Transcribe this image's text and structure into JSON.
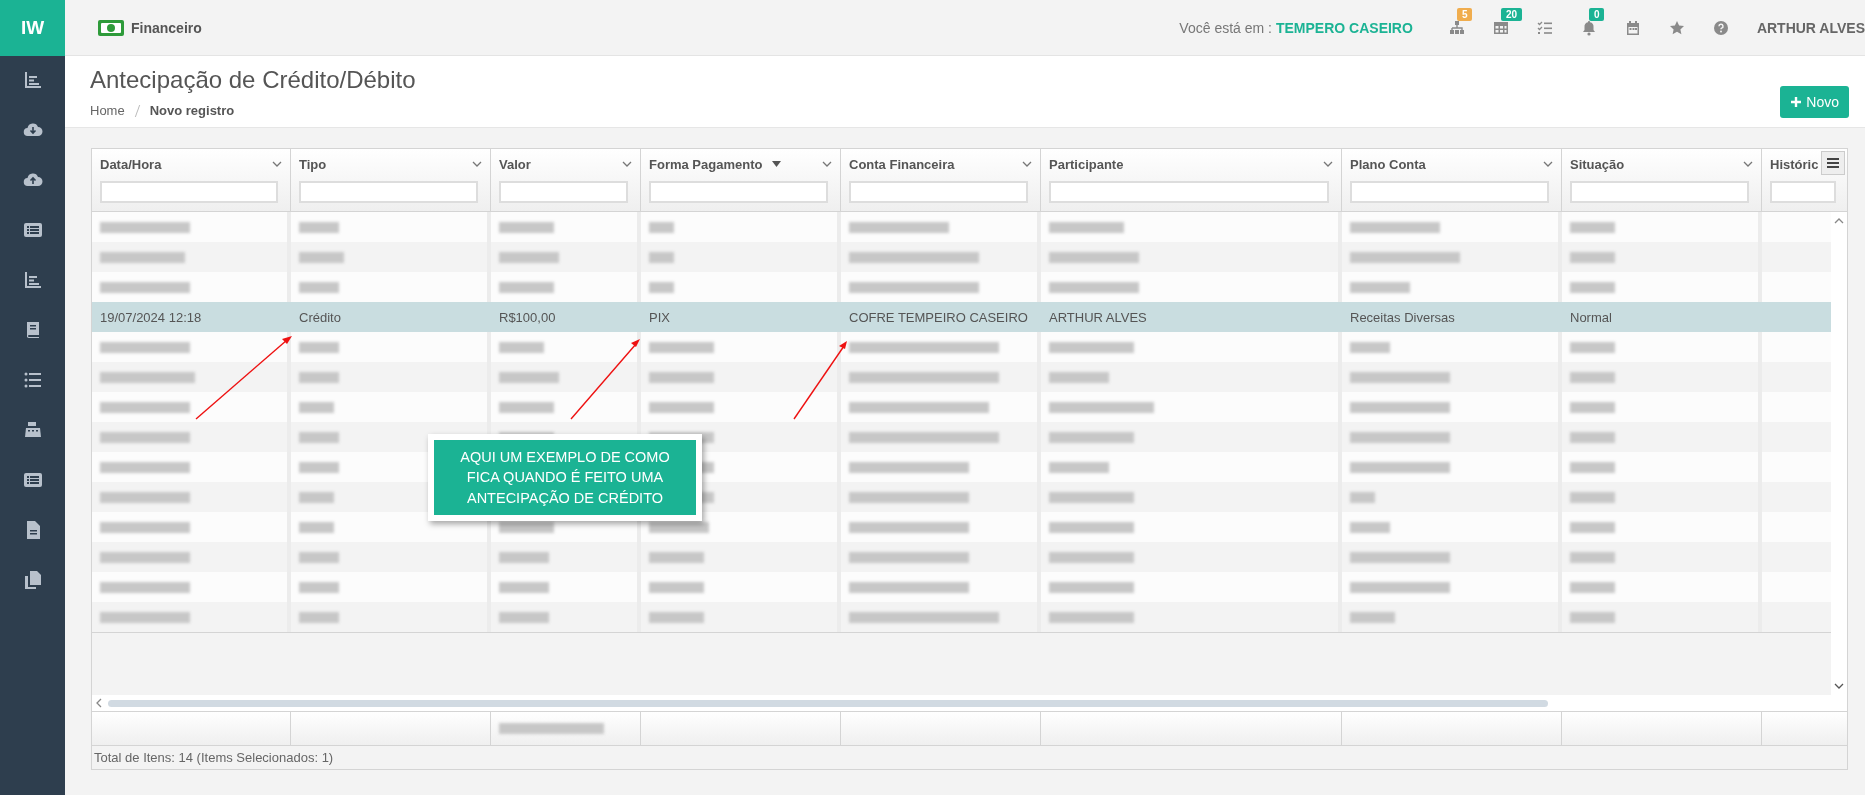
{
  "sidebar": {
    "logo": "IW",
    "items": [
      {
        "kind": "chart"
      },
      {
        "kind": "cloud-down"
      },
      {
        "kind": "cloud-up"
      },
      {
        "kind": "list-box"
      },
      {
        "kind": "chart"
      },
      {
        "kind": "book"
      },
      {
        "kind": "list"
      },
      {
        "kind": "register"
      },
      {
        "kind": "list-box"
      },
      {
        "kind": "file"
      },
      {
        "kind": "copy"
      }
    ]
  },
  "topbar": {
    "module": "Financeiro",
    "location_label": "Você está em :",
    "location": "TEMPERO CASEIRO",
    "icons": [
      {
        "kind": "sitemap",
        "badge": "5",
        "color": "#f0ad4e"
      },
      {
        "kind": "table",
        "badge": "20",
        "color": "#1bb394"
      },
      {
        "kind": "tasks"
      },
      {
        "kind": "bell",
        "badge": "0",
        "color": "#1bb394"
      },
      {
        "kind": "calendar"
      },
      {
        "kind": "star"
      },
      {
        "kind": "help"
      }
    ],
    "user": "ARTHUR ALVES"
  },
  "page": {
    "title": "Antecipação de Crédito/Débito",
    "breadcrumb": [
      "Home",
      "Novo registro"
    ],
    "new_button": "Novo"
  },
  "table": {
    "columns": [
      {
        "label": "Data/Hora",
        "sorted": false
      },
      {
        "label": "Tipo",
        "sorted": false
      },
      {
        "label": "Valor",
        "sorted": false
      },
      {
        "label": "Forma Pagamento",
        "sorted": true
      },
      {
        "label": "Conta Financeira",
        "sorted": false
      },
      {
        "label": "Participante",
        "sorted": false
      },
      {
        "label": "Plano Conta",
        "sorted": false
      },
      {
        "label": "Situação",
        "sorted": false
      },
      {
        "label": "Históric",
        "sorted": false
      }
    ],
    "rows": [
      {
        "kind": "redacted",
        "selected": false
      },
      {
        "kind": "redacted",
        "selected": false
      },
      {
        "kind": "redacted",
        "selected": false
      },
      {
        "kind": "data",
        "selected": true,
        "cells": [
          "19/07/2024 12:18",
          "Crédito",
          "R$100,00",
          "PIX",
          "COFRE TEMPEIRO CASEIRO",
          "ARTHUR ALVES",
          "Receitas Diversas",
          "Normal",
          ""
        ]
      },
      {
        "kind": "redacted",
        "selected": false
      },
      {
        "kind": "redacted",
        "selected": false
      },
      {
        "kind": "redacted",
        "selected": false
      },
      {
        "kind": "redacted",
        "selected": false
      },
      {
        "kind": "redacted",
        "selected": false
      },
      {
        "kind": "redacted",
        "selected": false
      },
      {
        "kind": "redacted",
        "selected": false
      },
      {
        "kind": "redacted",
        "selected": false
      },
      {
        "kind": "redacted",
        "selected": false
      },
      {
        "kind": "redacted",
        "selected": false
      }
    ],
    "status": "Total de Itens: 14 (Items Selecionados: 1)"
  },
  "callout": {
    "text": "AQUI UM EXEMPLO DE COMO FICA QUANDO É FEITO UMA ANTECIPAÇÃO DE CRÉDITO"
  }
}
